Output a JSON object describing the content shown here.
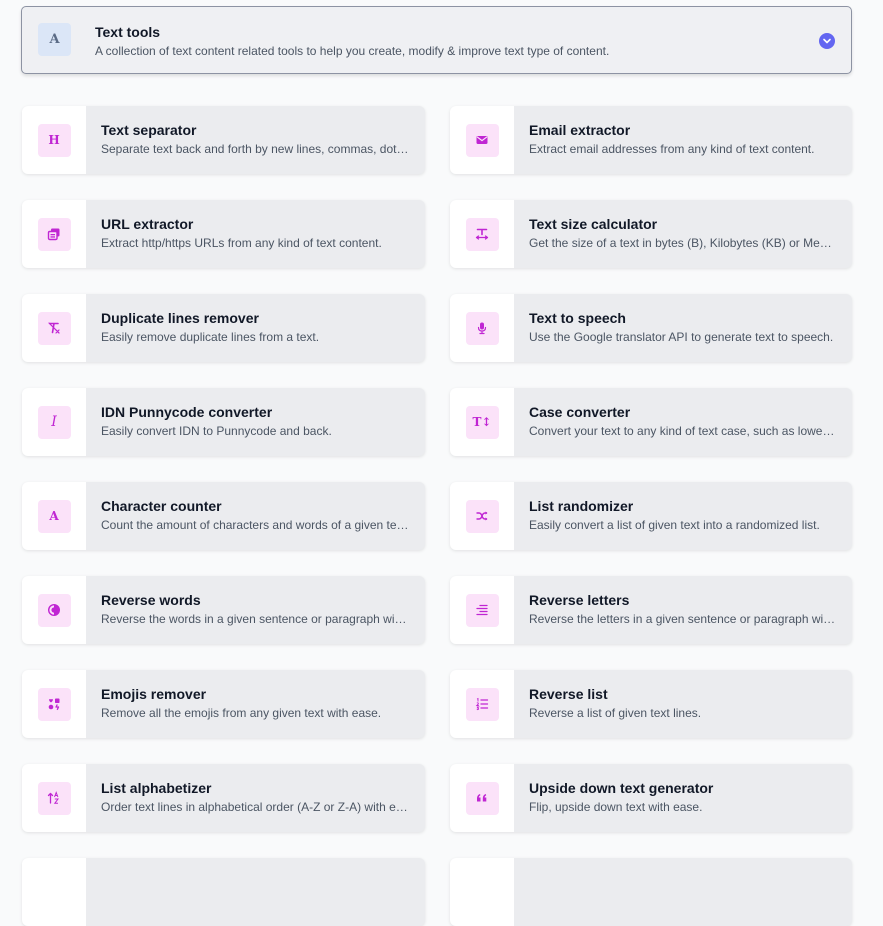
{
  "header": {
    "icon_letter": "A",
    "title": "Text tools",
    "description": "A collection of text content related tools to help you create, modify & improve text type of content."
  },
  "tools": [
    {
      "title": "Text separator",
      "description": "Separate text back and forth by new lines, commas, dots, and more.",
      "icon": "heading-icon",
      "glyph": "H"
    },
    {
      "title": "Email extractor",
      "description": "Extract email addresses from any kind of text content.",
      "icon": "envelope-icon"
    },
    {
      "title": "URL extractor",
      "description": "Extract http/https URLs from any kind of text content.",
      "icon": "copy-link-icon"
    },
    {
      "title": "Text size calculator",
      "description": "Get the size of a text in bytes (B), Kilobytes (KB) or Megabytes (MB).",
      "icon": "text-width-icon"
    },
    {
      "title": "Duplicate lines remover",
      "description": "Easily remove duplicate lines from a text.",
      "icon": "remove-format-icon"
    },
    {
      "title": "Text to speech",
      "description": "Use the Google translator API to generate text to speech.",
      "icon": "microphone-icon"
    },
    {
      "title": "IDN Punnycode converter",
      "description": "Easily convert IDN to Punnycode and back.",
      "icon": "italic-icon",
      "glyph": "I"
    },
    {
      "title": "Case converter",
      "description": "Convert your text to any kind of text case, such as lowercase, uppercase and more.",
      "icon": "text-height-icon",
      "glyph": "T↕"
    },
    {
      "title": "Character counter",
      "description": "Count the amount of characters and words of a given text.",
      "icon": "font-icon",
      "glyph": "A"
    },
    {
      "title": "List randomizer",
      "description": "Easily convert a list of given text into a randomized list.",
      "icon": "shuffle-icon"
    },
    {
      "title": "Reverse words",
      "description": "Reverse the words in a given sentence or paragraph with ease.",
      "icon": "adjust-icon"
    },
    {
      "title": "Reverse letters",
      "description": "Reverse the letters in a given sentence or paragraph with ease.",
      "icon": "align-right-icon"
    },
    {
      "title": "Emojis remover",
      "description": "Remove all the emojis from any given text with ease.",
      "icon": "icons-icon"
    },
    {
      "title": "Reverse list",
      "description": "Reverse a list of given text lines.",
      "icon": "list-ol-icon"
    },
    {
      "title": "List alphabetizer",
      "description": "Order text lines in alphabetical order (A-Z or Z-A) with ease.",
      "icon": "sort-alpha-icon"
    },
    {
      "title": "Upside down text generator",
      "description": "Flip, upside down text with ease.",
      "icon": "quote-left-icon"
    }
  ],
  "colors": {
    "accent": "#6366f1",
    "icon_bg": "#fbe2f9",
    "icon_fg": "#c026d3",
    "card_bg": "#ebecef"
  }
}
